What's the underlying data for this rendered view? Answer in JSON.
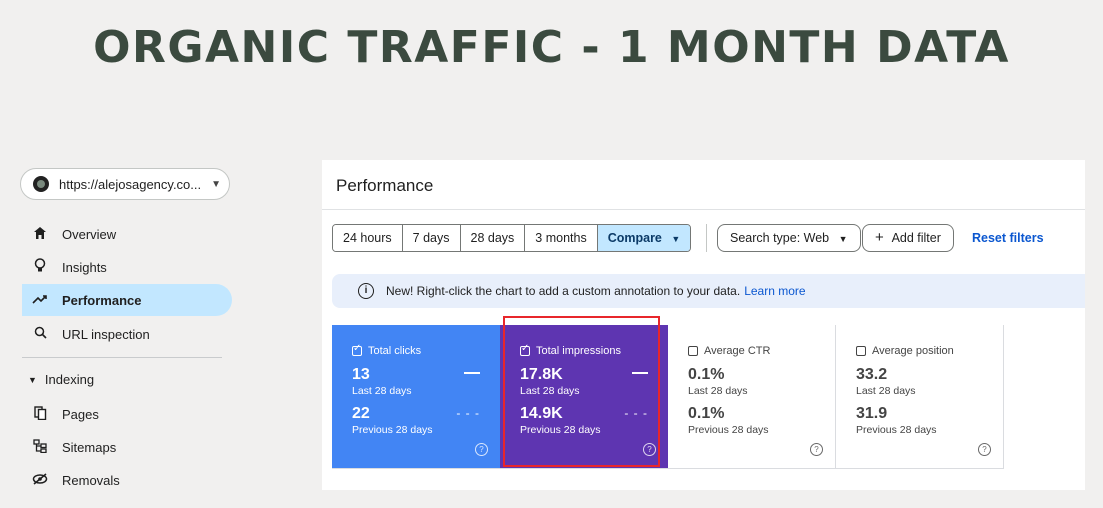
{
  "headline": "ORGANIC TRAFFIC - 1 MONTH DATA",
  "sidebar": {
    "property": "https://alejosagency.co...",
    "items": [
      {
        "label": "Overview",
        "icon": "home-icon"
      },
      {
        "label": "Insights",
        "icon": "bulb-icon"
      },
      {
        "label": "Performance",
        "icon": "trend-icon",
        "active": true
      },
      {
        "label": "URL inspection",
        "icon": "search-icon"
      }
    ],
    "section": "Indexing",
    "section_items": [
      {
        "label": "Pages",
        "icon": "pages-icon"
      },
      {
        "label": "Sitemaps",
        "icon": "sitemap-icon"
      },
      {
        "label": "Removals",
        "icon": "removals-icon"
      }
    ]
  },
  "main": {
    "title": "Performance",
    "ranges": [
      "24 hours",
      "7 days",
      "28 days",
      "3 months"
    ],
    "compare_label": "Compare",
    "search_type": "Search type: Web",
    "add_filter": "Add filter",
    "reset_filters": "Reset filters",
    "banner_text": "New! Right-click the chart to add a custom annotation to your data.",
    "banner_link": "Learn more"
  },
  "metrics": [
    {
      "label": "Total clicks",
      "checked": true,
      "current": "13",
      "current_period": "Last 28 days",
      "previous": "22",
      "previous_period": "Previous 28 days",
      "color": "#4285f4"
    },
    {
      "label": "Total impressions",
      "checked": true,
      "current": "17.8K",
      "current_period": "Last 28 days",
      "previous": "14.9K",
      "previous_period": "Previous 28 days",
      "color": "#5e35b1"
    },
    {
      "label": "Average CTR",
      "checked": false,
      "current": "0.1%",
      "current_period": "Last 28 days",
      "previous": "0.1%",
      "previous_period": "Previous 28 days"
    },
    {
      "label": "Average position",
      "checked": false,
      "current": "33.2",
      "current_period": "Last 28 days",
      "previous": "31.9",
      "previous_period": "Previous 28 days"
    }
  ]
}
